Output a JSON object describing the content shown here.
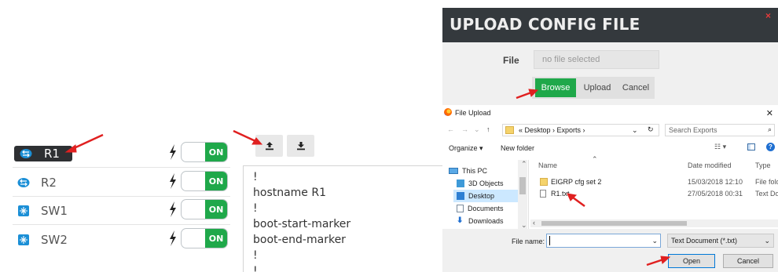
{
  "nodes": [
    {
      "name": "R1",
      "type": "router",
      "power": "ON",
      "selected": true
    },
    {
      "name": "R2",
      "type": "router",
      "power": "ON",
      "selected": false
    },
    {
      "name": "SW1",
      "type": "switch",
      "power": "ON",
      "selected": false
    },
    {
      "name": "SW2",
      "type": "switch",
      "power": "ON",
      "selected": false
    }
  ],
  "editor": {
    "upload_icon": "upload-icon",
    "download_icon": "download-icon",
    "lines": [
      "!",
      "hostname R1",
      "!",
      "boot-start-marker",
      "boot-end-marker",
      "!",
      "!"
    ]
  },
  "upload_dialog": {
    "title": "UPLOAD CONFIG FILE",
    "close": "×",
    "file_label": "File",
    "file_placeholder": "no file selected",
    "browse_label": "Browse",
    "upload_label": "Upload",
    "cancel_label": "Cancel"
  },
  "file_dialog": {
    "title": "File Upload",
    "close": "✕",
    "breadcrumb": "« Desktop › Exports ›",
    "search_placeholder": "Search Exports",
    "organize_label": "Organize ▾",
    "new_folder_label": "New folder",
    "nav_items": [
      "This PC",
      "3D Objects",
      "Desktop",
      "Documents",
      "Downloads"
    ],
    "columns": {
      "name": "Name",
      "date": "Date modified",
      "type": "Type"
    },
    "files": [
      {
        "name": "EIGRP cfg set 2",
        "date": "15/03/2018 12:10",
        "type": "File fold",
        "kind": "folder"
      },
      {
        "name": "R1.txt",
        "date": "27/05/2018 00:31",
        "type": "Text Do",
        "kind": "file"
      }
    ],
    "filename_label": "File name:",
    "filetype_value": "Text Document (*.txt)",
    "open_label": "Open",
    "cancel_label": "Cancel"
  },
  "colors": {
    "green": "#1fa84a",
    "dark_header": "#34393d",
    "arrow_red": "#e02020"
  }
}
